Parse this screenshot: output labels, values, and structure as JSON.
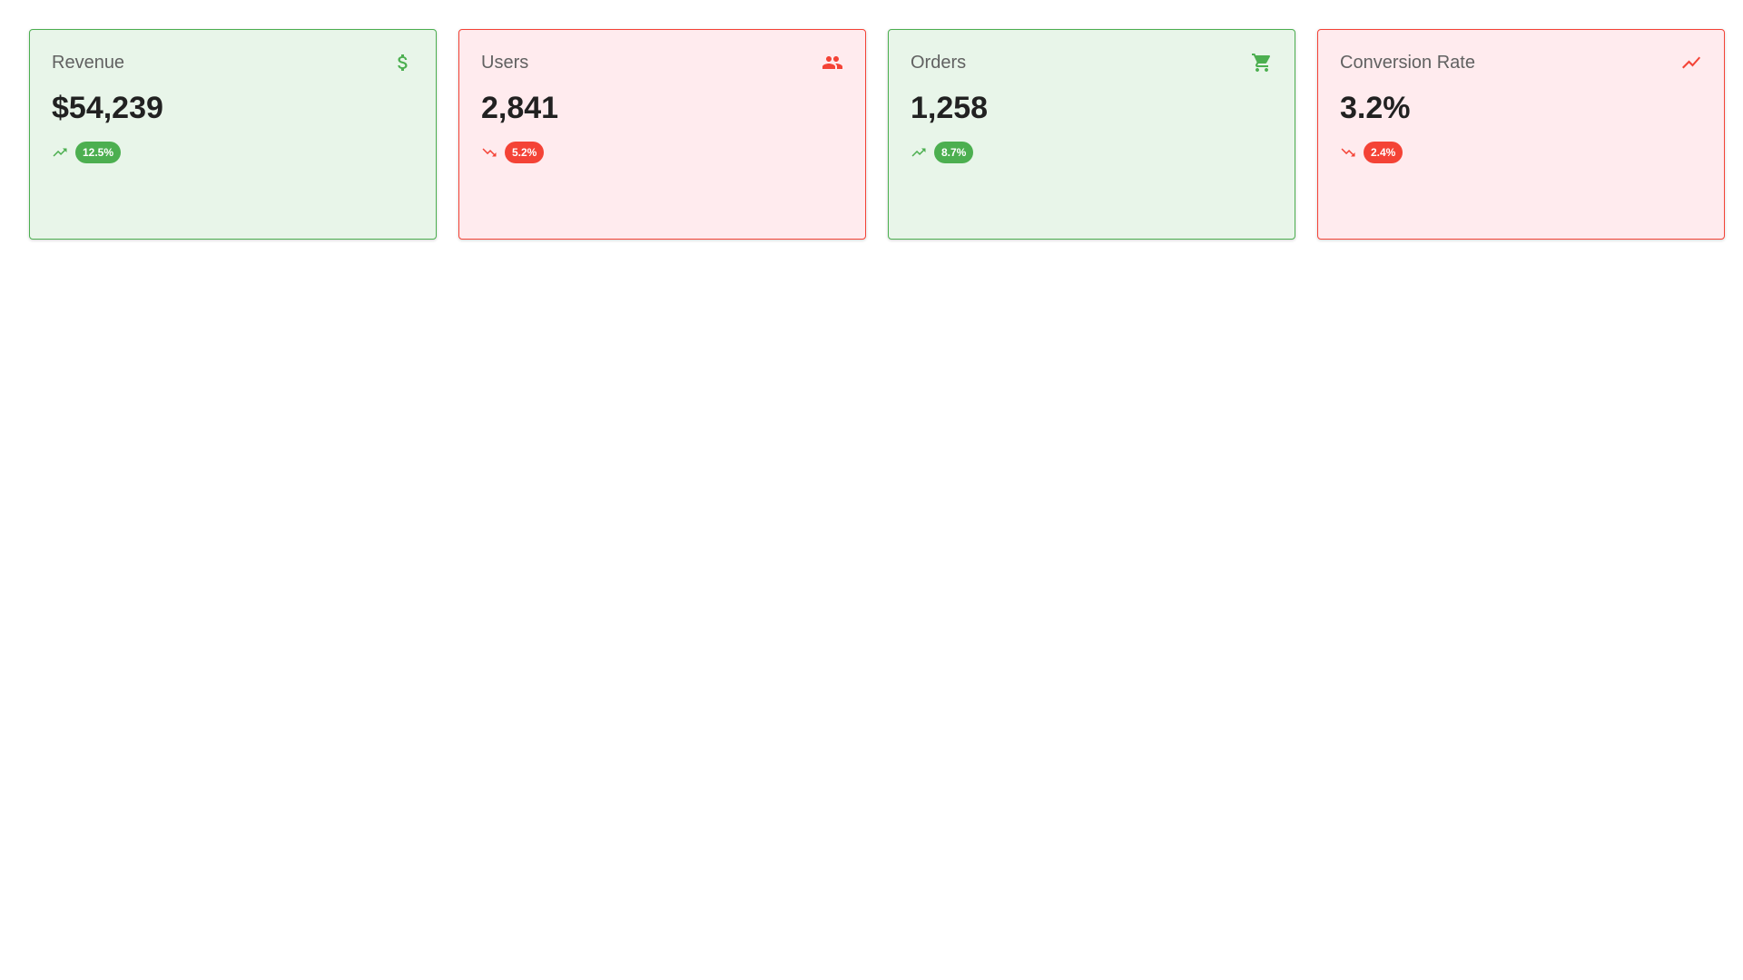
{
  "cards": [
    {
      "title": "Revenue",
      "value": "$54,239",
      "change": "12.5%",
      "direction": "up",
      "icon": "dollar-icon",
      "color": "#4caf50"
    },
    {
      "title": "Users",
      "value": "2,841",
      "change": "5.2%",
      "direction": "down",
      "icon": "people-icon",
      "color": "#f44336"
    },
    {
      "title": "Orders",
      "value": "1,258",
      "change": "8.7%",
      "direction": "up",
      "icon": "shopping-cart-icon",
      "color": "#4caf50"
    },
    {
      "title": "Conversion Rate",
      "value": "3.2%",
      "change": "2.4%",
      "direction": "down",
      "icon": "line-chart-icon",
      "color": "#f44336"
    }
  ],
  "colors": {
    "positive_bg": "#e8f5e9",
    "positive_accent": "#4caf50",
    "negative_bg": "#ffebee",
    "negative_accent": "#f44336"
  }
}
